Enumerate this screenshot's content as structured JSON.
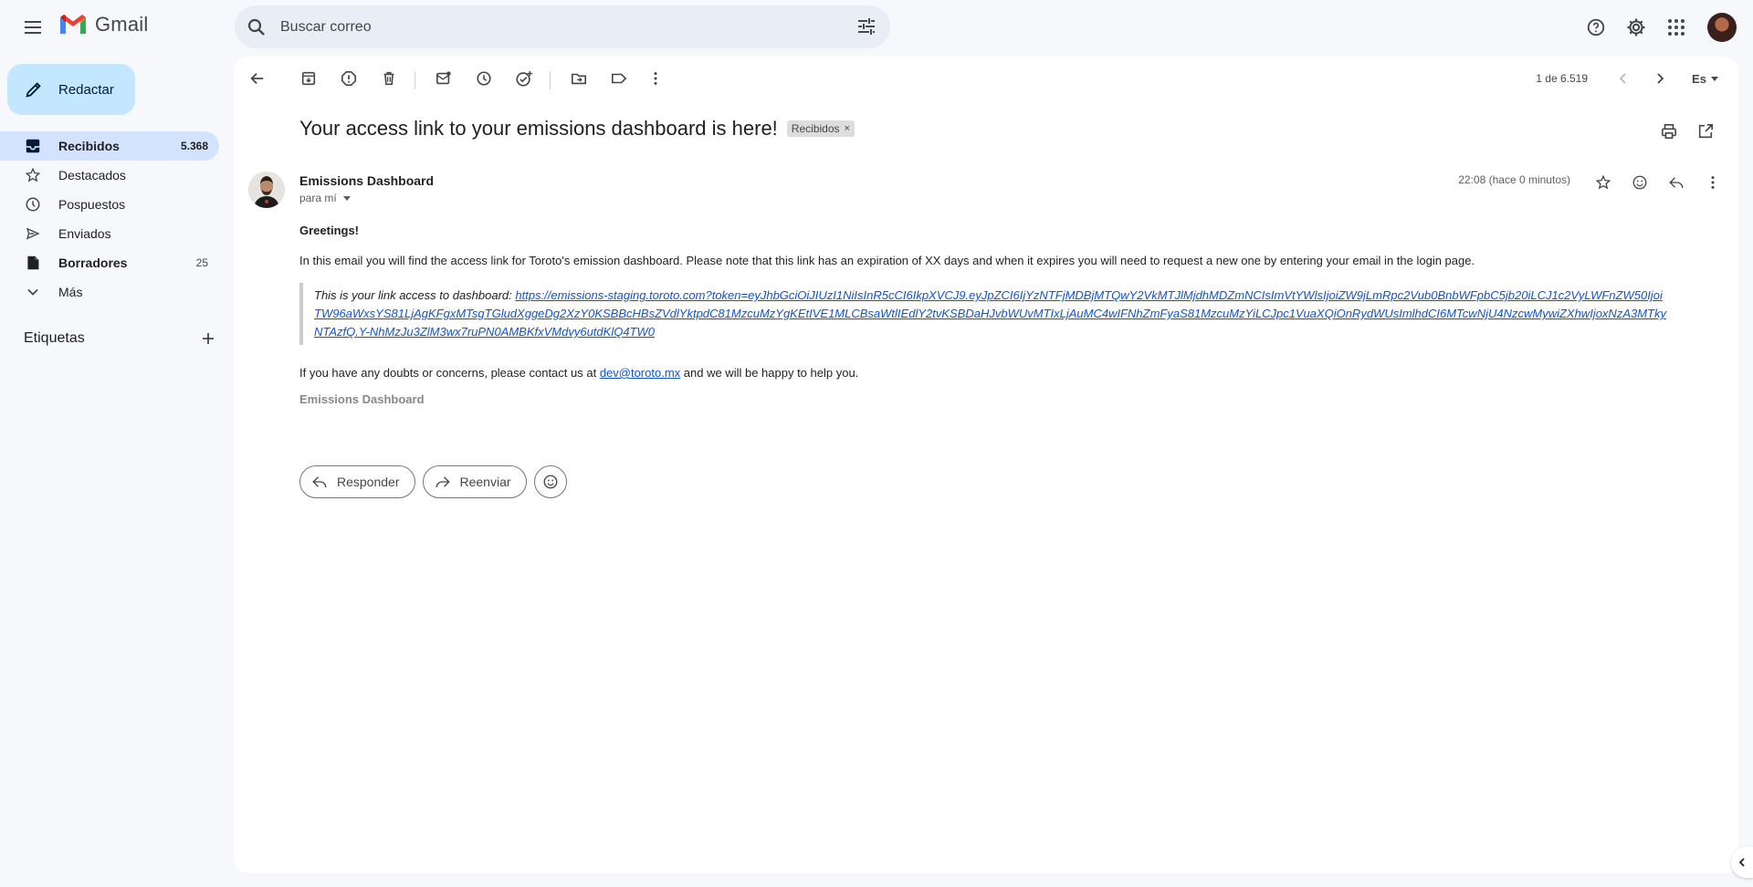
{
  "app": {
    "name": "Gmail"
  },
  "search": {
    "placeholder": "Buscar correo"
  },
  "sidebar": {
    "compose_label": "Redactar",
    "items": [
      {
        "label": "Recibidos",
        "count": "5.368",
        "icon": "inbox-icon"
      },
      {
        "label": "Destacados",
        "count": "",
        "icon": "star-icon"
      },
      {
        "label": "Pospuestos",
        "count": "",
        "icon": "clock-icon"
      },
      {
        "label": "Enviados",
        "count": "",
        "icon": "send-icon"
      },
      {
        "label": "Borradores",
        "count": "25",
        "icon": "draft-icon"
      },
      {
        "label": "Más",
        "count": "",
        "icon": "chevron-down-icon"
      }
    ],
    "labels_heading": "Etiquetas"
  },
  "toolbar": {
    "pager": "1 de 6.519",
    "lang": "Es"
  },
  "email": {
    "subject": "Your access link to your emissions dashboard is here!",
    "label_chip": "Recibidos",
    "sender_name": "Emissions Dashboard",
    "to": "para mí",
    "time": "22:08 (hace 0 minutos)",
    "greeting": "Greetings!",
    "paragraph1": "In this email you will find the access link for Toroto's emission dashboard. Please note that this link has an expiration of XX days and when it expires you will need to request a new one by entering your email in the login page.",
    "quote_prefix": "This is your link access to dashboard: ",
    "link": "https://emissions-staging.toroto.com?token=eyJhbGciOiJIUzI1NiIsInR5cCI6IkpXVCJ9.eyJpZCI6IjYzNTFjMDBjMTQwY2VkMTJlMjdhMDZmNCIsImVtYWlsIjoiZW9jLmRpc2Vub0BnbWFpbC5jb20iLCJ1c2VyLWFnZW50IjoiTW96aWxsYS81LjAgKFgxMTsgTGludXggeDg2XzY0KSBBcHBsZVdlYktpdC81MzcuMzYgKEtIVE1MLCBsaWtlIEdlY2tvKSBDaHJvbWUvMTIxLjAuMC4wIFNhZmFyaS81MzcuMzYiLCJpc1VuaXQiOnRydWUsImlhdCI6MTcwNjU4NzcwMywiZXhwIjoxNzA3MTkyNTAzfQ.Y-NhMzJu3ZlM3wx7ruPN0AMBKfxVMdvy6utdKlQ4TW0",
    "contact_prefix": "If you have any doubts or concerns, please contact us at ",
    "contact_email": "dev@toroto.mx",
    "contact_suffix": " and we will be happy to help you.",
    "signature": "Emissions Dashboard"
  },
  "actions": {
    "reply": "Responder",
    "forward": "Reenviar"
  },
  "colors": {
    "accent": "#c2e7ff",
    "active_nav": "#d3e3fd",
    "link": "#1155cc",
    "background": "#f6f8fc"
  }
}
